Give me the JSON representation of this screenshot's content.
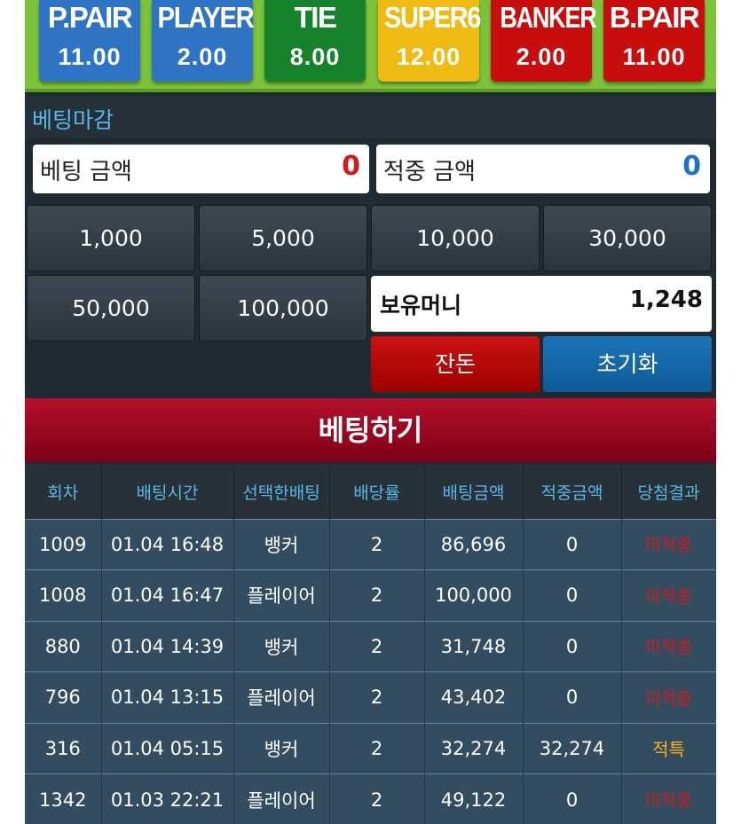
{
  "bet_options": [
    {
      "name": "P.PAIR",
      "odds": "11.00",
      "color": "#2f74c4"
    },
    {
      "name": "PLAYER",
      "odds": "2.00",
      "color": "#2f74c4"
    },
    {
      "name": "TIE",
      "odds": "8.00",
      "color": "#16822b"
    },
    {
      "name": "SUPER6",
      "odds": "12.00",
      "color": "#efbb12"
    },
    {
      "name": "BANKER",
      "odds": "2.00",
      "color": "#c80d0d"
    },
    {
      "name": "B.PAIR",
      "odds": "11.00",
      "color": "#c80d0d"
    }
  ],
  "status": "베팅마감",
  "bet_amount": {
    "label": "베팅 금액",
    "value": "0",
    "color": "#d31a1a"
  },
  "win_amount": {
    "label": "적중 금액",
    "value": "0",
    "color": "#1c72c8"
  },
  "chips": [
    "1,000",
    "5,000",
    "10,000",
    "30,000",
    "50,000",
    "100,000"
  ],
  "money": {
    "label": "보유머니",
    "value": "1,248"
  },
  "buttons": {
    "change": "잔돈",
    "reset": "초기화",
    "submit": "베팅하기"
  },
  "table": {
    "headers": [
      "회차",
      "배팅시간",
      "선택한배팅",
      "배당률",
      "배팅금액",
      "적중금액",
      "당첨결과"
    ],
    "rows": [
      {
        "round": "1009",
        "time": "01.04 16:48",
        "pick": "뱅커",
        "odds": "2",
        "bet": "86,696",
        "win": "0",
        "result": "미적중"
      },
      {
        "round": "1008",
        "time": "01.04 16:47",
        "pick": "플레이어",
        "odds": "2",
        "bet": "100,000",
        "win": "0",
        "result": "미적중"
      },
      {
        "round": "880",
        "time": "01.04 14:39",
        "pick": "뱅커",
        "odds": "2",
        "bet": "31,748",
        "win": "0",
        "result": "미적중"
      },
      {
        "round": "796",
        "time": "01.04 13:15",
        "pick": "플레이어",
        "odds": "2",
        "bet": "43,402",
        "win": "0",
        "result": "미적중"
      },
      {
        "round": "316",
        "time": "01.04 05:15",
        "pick": "뱅커",
        "odds": "2",
        "bet": "32,274",
        "win": "32,274",
        "result": "적특"
      },
      {
        "round": "1342",
        "time": "01.03 22:21",
        "pick": "플레이어",
        "odds": "2",
        "bet": "49,122",
        "win": "0",
        "result": "미적중"
      }
    ]
  }
}
